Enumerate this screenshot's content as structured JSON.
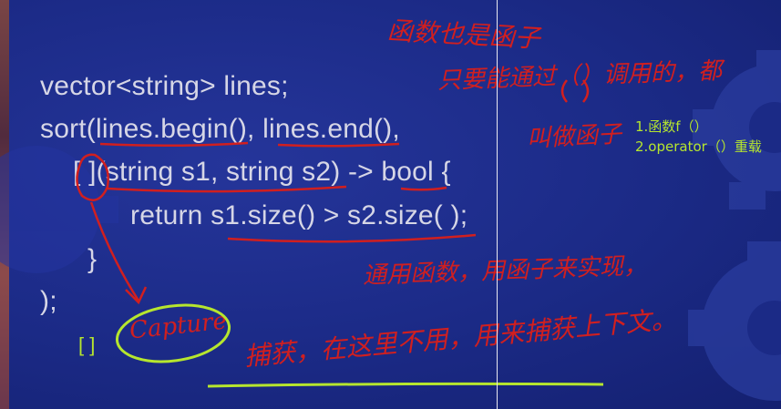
{
  "code": {
    "line1": "vector<string> lines;",
    "line2": "sort(lines.begin(), lines.end(),",
    "line3": "[ ](string s1, string s2) -> bool {",
    "line4": "return s1.size() > s2.size( );",
    "line5": "}",
    "line6": ");"
  },
  "side_note": {
    "item1": "1.函数f（）",
    "item2": "2.operator（）重载"
  },
  "brackets_label": "[ ]",
  "handwriting": {
    "title": "函数也是函子",
    "note1": "只要能通过（）调用的，都",
    "note2": "叫做函子",
    "note3": "通用函数，用函子来实现，",
    "note4": "捕获，在这里不用，用来捕获上下文。",
    "capture": "Capture"
  },
  "colors": {
    "background": "#1b2a86",
    "code_text": "#d6d6e6",
    "red_ink": "#d11f1f",
    "green_ink": "#b6e62e"
  }
}
